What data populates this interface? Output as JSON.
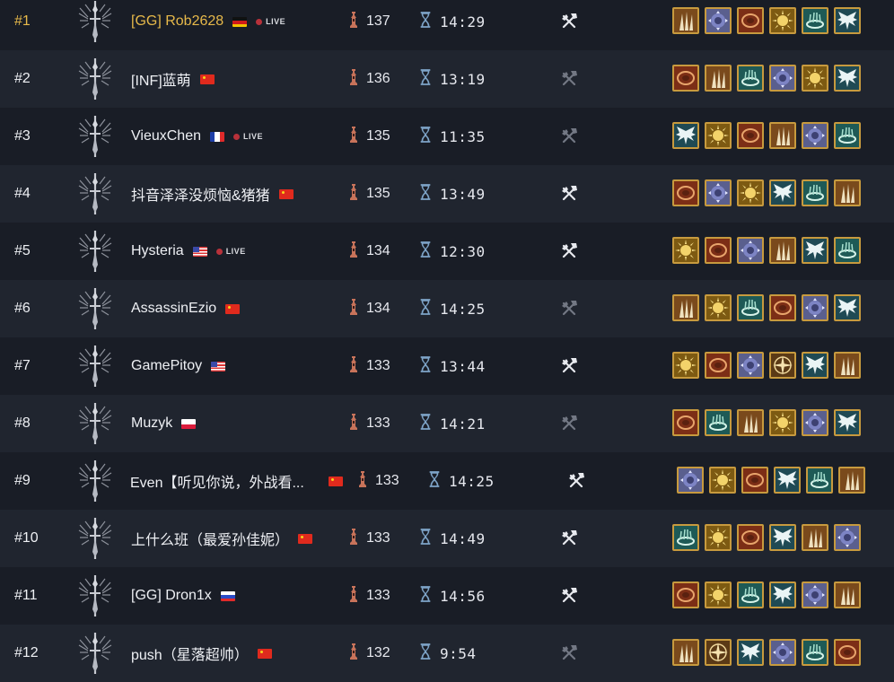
{
  "colors": {
    "gold_text": "#e7b94a",
    "row_dark": "#191d26",
    "row_light": "#20252f",
    "live_dot": "#b8313a",
    "frame_gold": "#c79a3e"
  },
  "icons": {
    "emblem": "sword-wings-emblem-icon",
    "floor": "tower-floor-icon",
    "time": "hourglass-icon",
    "weapon": "crossed-axe-hammer-icon"
  },
  "live_label": "LIVE",
  "rows": [
    {
      "rank": "#1",
      "name": "[GG] Rob2628",
      "flag": "de",
      "live": true,
      "floor": "137",
      "time": "14:29",
      "weapon_on": true,
      "blessings": [
        "claws",
        "sigil",
        "rune",
        "sun",
        "ring",
        "wings"
      ]
    },
    {
      "rank": "#2",
      "name": "[INF]蓝萌",
      "flag": "cn",
      "live": false,
      "floor": "136",
      "time": "13:19",
      "weapon_on": false,
      "blessings": [
        "rune",
        "claws",
        "ring",
        "sigil",
        "sun",
        "wings"
      ]
    },
    {
      "rank": "#3",
      "name": "VieuxChen",
      "flag": "fr",
      "live": true,
      "floor": "135",
      "time": "11:35",
      "weapon_on": false,
      "blessings": [
        "wings",
        "sun",
        "rune",
        "claws",
        "sigil",
        "ring"
      ]
    },
    {
      "rank": "#4",
      "name": "抖音泽泽没烦恼&猪猪",
      "flag": "cn",
      "live": false,
      "floor": "135",
      "time": "13:49",
      "weapon_on": true,
      "blessings": [
        "rune",
        "sigil",
        "sun",
        "wings",
        "ring",
        "claws"
      ]
    },
    {
      "rank": "#5",
      "name": "Hysteria",
      "flag": "us",
      "live": true,
      "floor": "134",
      "time": "12:30",
      "weapon_on": true,
      "blessings": [
        "sun",
        "rune",
        "sigil",
        "claws",
        "wings",
        "ring"
      ]
    },
    {
      "rank": "#6",
      "name": "AssassinEzio",
      "flag": "cn",
      "live": false,
      "floor": "134",
      "time": "14:25",
      "weapon_on": false,
      "blessings": [
        "claws",
        "sun",
        "ring",
        "rune",
        "sigil",
        "wings"
      ]
    },
    {
      "rank": "#7",
      "name": "GamePitoy",
      "flag": "us",
      "live": false,
      "floor": "133",
      "time": "13:44",
      "weapon_on": true,
      "blessings": [
        "sun",
        "rune",
        "sigil",
        "compass",
        "wings",
        "claws"
      ]
    },
    {
      "rank": "#8",
      "name": "Muzyk",
      "flag": "pl",
      "live": false,
      "floor": "133",
      "time": "14:21",
      "weapon_on": false,
      "blessings": [
        "rune",
        "ring",
        "claws",
        "sun",
        "sigil",
        "wings"
      ]
    },
    {
      "rank": "#9",
      "name": "Even【听见你说，外战看...",
      "flag": "cn",
      "live": false,
      "floor": "133",
      "time": "14:25",
      "weapon_on": true,
      "blessings": [
        "sigil",
        "sun",
        "rune",
        "wings",
        "ring",
        "claws"
      ]
    },
    {
      "rank": "#10",
      "name": "上什么班（最爱孙佳妮）",
      "flag": "cn",
      "live": false,
      "floor": "133",
      "time": "14:49",
      "weapon_on": true,
      "blessings": [
        "ring",
        "sun",
        "rune",
        "wings",
        "claws",
        "sigil"
      ]
    },
    {
      "rank": "#11",
      "name": "[GG] Dron1x",
      "flag": "ru",
      "live": false,
      "floor": "133",
      "time": "14:56",
      "weapon_on": true,
      "blessings": [
        "rune",
        "sun",
        "ring",
        "wings",
        "sigil",
        "claws"
      ]
    },
    {
      "rank": "#12",
      "name": "push（星落超帅）",
      "flag": "cn",
      "live": false,
      "floor": "132",
      "time": "9:54",
      "weapon_on": false,
      "blessings": [
        "claws",
        "compass",
        "wings",
        "sigil",
        "ring",
        "rune"
      ]
    }
  ]
}
